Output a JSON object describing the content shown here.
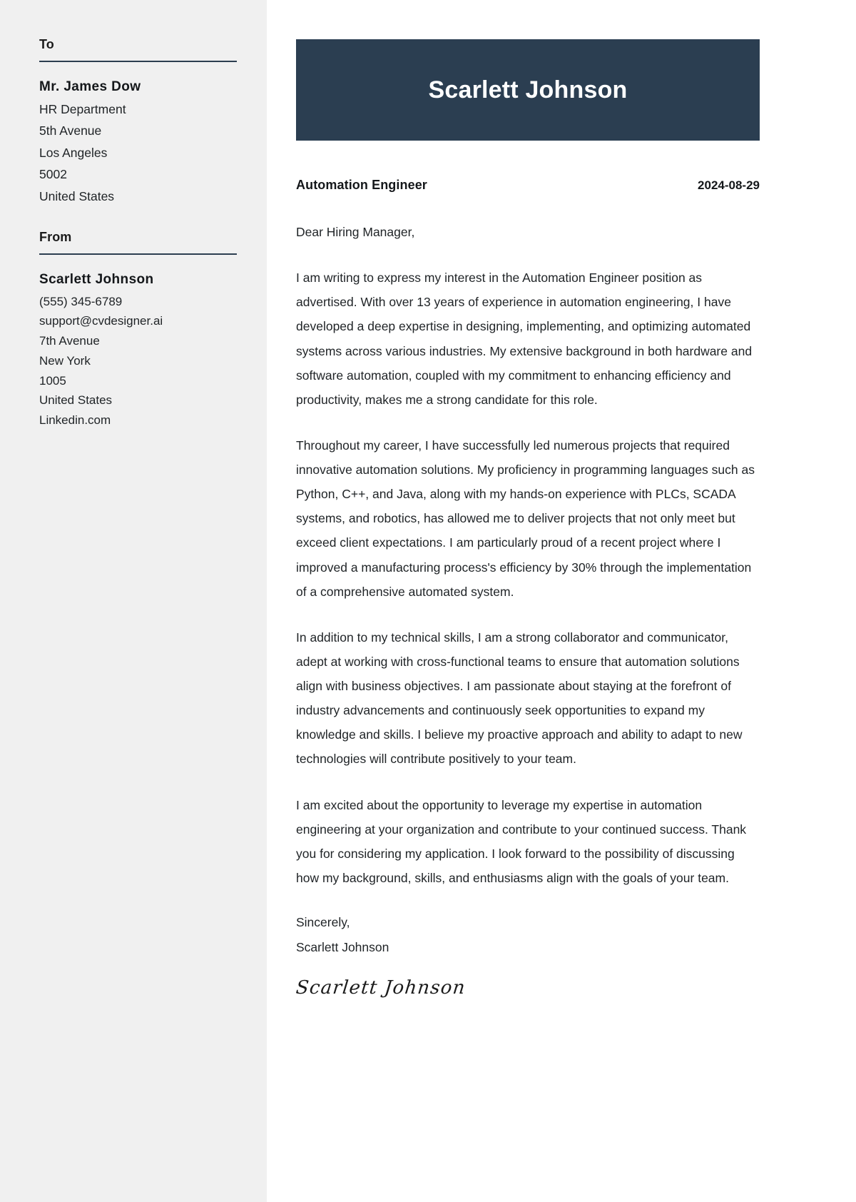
{
  "sidebar": {
    "to": {
      "heading": "To",
      "name": "Mr. James Dow",
      "lines": [
        "HR Department",
        "5th Avenue",
        "Los Angeles",
        "5002",
        "United States"
      ]
    },
    "from": {
      "heading": "From",
      "name": "Scarlett Johnson",
      "lines": [
        "(555) 345-6789",
        "support@cvdesigner.ai",
        "7th Avenue",
        "New York",
        "1005",
        "United States",
        "Linkedin.com"
      ]
    }
  },
  "letter": {
    "banner_name": "Scarlett Johnson",
    "job_title": "Automation Engineer",
    "date": "2024-08-29",
    "salutation": "Dear Hiring Manager,",
    "paragraphs": [
      "I am writing to express my interest in the Automation Engineer position as advertised. With over 13 years of experience in automation engineering, I have developed a deep expertise in designing, implementing, and optimizing automated systems across various industries. My extensive background in both hardware and software automation, coupled with my commitment to enhancing efficiency and productivity, makes me a strong candidate for this role.",
      "Throughout my career, I have successfully led numerous projects that required innovative automation solutions. My proficiency in programming languages such as Python, C++, and Java, along with my hands-on experience with PLCs, SCADA systems, and robotics, has allowed me to deliver projects that not only meet but exceed client expectations. I am particularly proud of a recent project where I improved a manufacturing process's efficiency by 30% through the implementation of a comprehensive automated system.",
      "In addition to my technical skills, I am a strong collaborator and communicator, adept at working with cross-functional teams to ensure that automation solutions align with business objectives. I am passionate about staying at the forefront of industry advancements and continuously seek opportunities to expand my knowledge and skills. I believe my proactive approach and ability to adapt to new technologies will contribute positively to your team.",
      "I am excited about the opportunity to leverage my expertise in automation engineering at your organization and contribute to your continued success. Thank you for considering my application. I look forward to the possibility of discussing how my background, skills, and enthusiasms align with the goals of your team."
    ],
    "closing_word": "Sincerely,",
    "closing_name": "Scarlett Johnson",
    "signature": "Scarlett Johnson"
  },
  "colors": {
    "banner": "#2b3e51",
    "sidebar_bg": "#f0f0f0",
    "rule": "#2c3e50",
    "text": "#1f2326"
  }
}
